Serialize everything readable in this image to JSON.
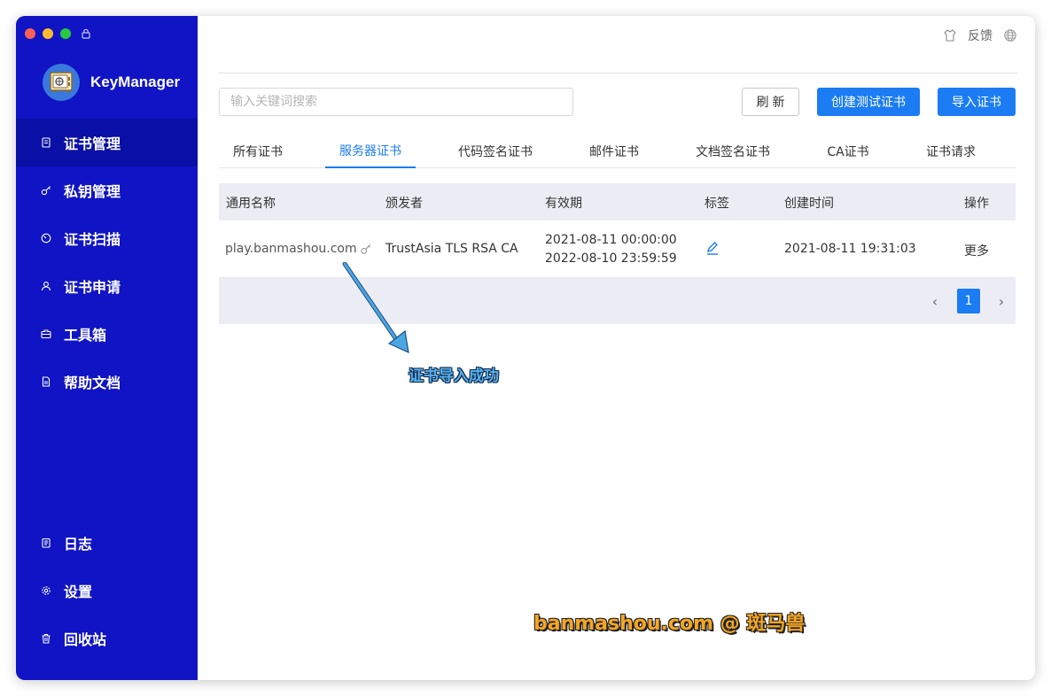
{
  "app": {
    "name": "KeyManager"
  },
  "topbar": {
    "feedback_label": "反馈"
  },
  "sidebar": {
    "items": [
      {
        "label": "证书管理",
        "icon": "certificate-icon",
        "active": true
      },
      {
        "label": "私钥管理",
        "icon": "key-icon"
      },
      {
        "label": "证书扫描",
        "icon": "scan-icon"
      },
      {
        "label": "证书申请",
        "icon": "user-icon"
      },
      {
        "label": "工具箱",
        "icon": "toolbox-icon"
      },
      {
        "label": "帮助文档",
        "icon": "document-icon"
      }
    ],
    "bottom_items": [
      {
        "label": "日志",
        "icon": "log-icon"
      },
      {
        "label": "设置",
        "icon": "settings-icon"
      },
      {
        "label": "回收站",
        "icon": "trash-icon"
      }
    ]
  },
  "search": {
    "placeholder": "输入关键词搜索"
  },
  "toolbar": {
    "refresh_label": "刷新",
    "create_test_label": "创建测试证书",
    "import_label": "导入证书"
  },
  "tabs": [
    "所有证书",
    "服务器证书",
    "代码签名证书",
    "邮件证书",
    "文档签名证书",
    "CA证书",
    "证书请求"
  ],
  "active_tab": "服务器证书",
  "table": {
    "headers": [
      "通用名称",
      "颁发者",
      "有效期",
      "标签",
      "创建时间",
      "操作"
    ],
    "rows": [
      {
        "common_name": "play.banmashou.com",
        "issuer": "TrustAsia TLS RSA CA",
        "valid_from": "2021-08-11 00:00:00",
        "valid_to": "2022-08-10 23:59:59",
        "created": "2021-08-11 19:31:03",
        "action": "更多"
      }
    ]
  },
  "pagination": {
    "current_page": "1"
  },
  "annotation": {
    "text": "证书导入成功"
  },
  "watermark": {
    "text": "banmashou.com @ 斑马兽"
  },
  "colors": {
    "sidebar": "#1014c4",
    "accent": "#1b7cf4"
  }
}
